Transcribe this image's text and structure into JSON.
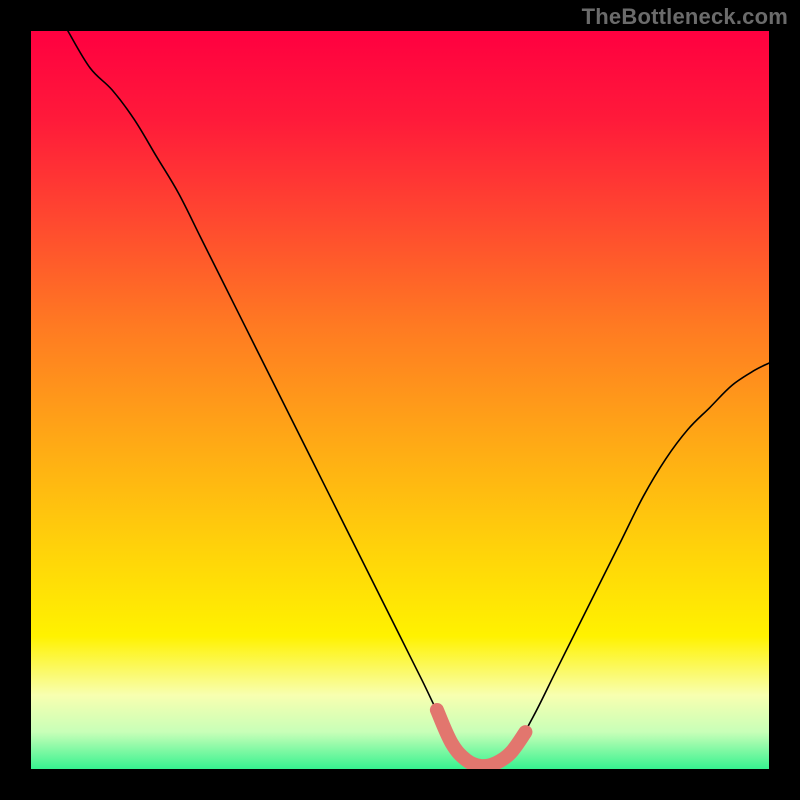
{
  "watermark": "TheBottleneck.com",
  "colors": {
    "frame_background": "#000000",
    "curve_stroke": "#000000",
    "plateau_stroke": "#e2766e",
    "gradient_stops": [
      {
        "offset": "0%",
        "color": "#ff0040"
      },
      {
        "offset": "12%",
        "color": "#ff1a3a"
      },
      {
        "offset": "25%",
        "color": "#ff4630"
      },
      {
        "offset": "40%",
        "color": "#ff7a22"
      },
      {
        "offset": "55%",
        "color": "#ffa716"
      },
      {
        "offset": "70%",
        "color": "#ffd20a"
      },
      {
        "offset": "82%",
        "color": "#fff200"
      },
      {
        "offset": "90%",
        "color": "#f8ffb0"
      },
      {
        "offset": "95%",
        "color": "#c8ffb8"
      },
      {
        "offset": "100%",
        "color": "#36f28f"
      }
    ]
  },
  "chart_data": {
    "type": "line",
    "title": "",
    "xlabel": "",
    "ylabel": "",
    "xlim": [
      0,
      100
    ],
    "ylim": [
      0,
      100
    ],
    "grid": false,
    "legend": false,
    "annotations": [],
    "series": [
      {
        "name": "curve",
        "color": "#000000",
        "x": [
          5,
          8,
          11,
          14,
          17,
          20,
          23,
          26,
          29,
          32,
          35,
          38,
          41,
          44,
          47,
          50,
          53,
          56,
          59,
          62,
          65,
          68,
          71,
          74,
          77,
          80,
          83,
          86,
          89,
          92,
          95,
          98,
          100
        ],
        "y": [
          100,
          95,
          92,
          88,
          83,
          78,
          72,
          66,
          60,
          54,
          48,
          42,
          36,
          30,
          24,
          18,
          12,
          6,
          2,
          0,
          2,
          7,
          13,
          19,
          25,
          31,
          37,
          42,
          46,
          49,
          52,
          54,
          55
        ]
      },
      {
        "name": "plateau",
        "color": "#e2766e",
        "x": [
          55,
          57,
          59,
          61,
          63,
          65,
          67
        ],
        "y": [
          8,
          3.5,
          1.2,
          0.4,
          0.8,
          2.2,
          5
        ]
      }
    ]
  }
}
